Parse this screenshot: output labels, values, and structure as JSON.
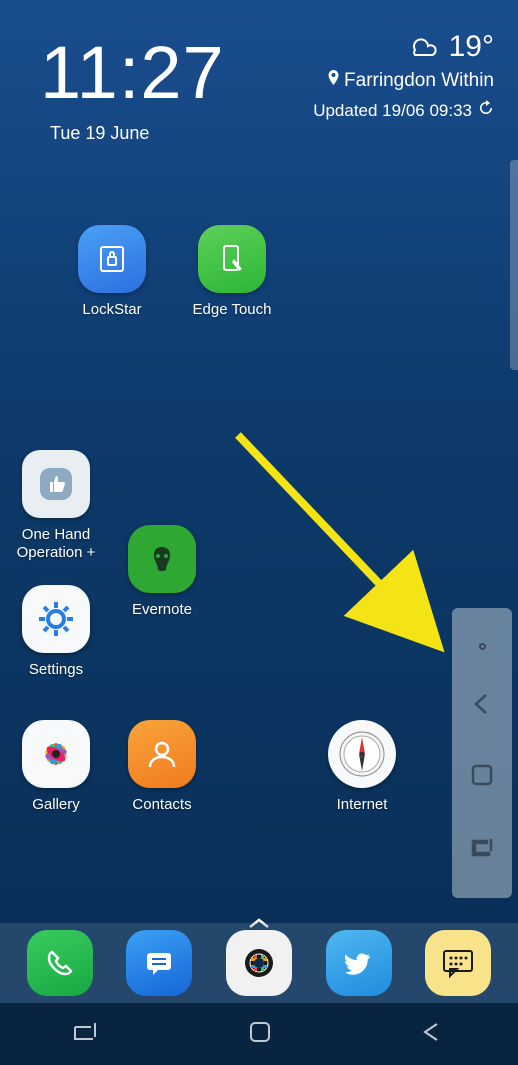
{
  "clock": {
    "time": "11:27",
    "date": "Tue 19 June"
  },
  "weather": {
    "temp": "19°",
    "location": "Farringdon Within",
    "updated": "Updated 19/06 09:33"
  },
  "apps": {
    "lockstar": "LockStar",
    "edgetouch": "Edge Touch",
    "onehand": "One Hand Operation +",
    "evernote": "Evernote",
    "settings": "Settings",
    "gallery": "Gallery",
    "contacts": "Contacts",
    "internet": "Internet"
  },
  "dock": {
    "phone": "Phone",
    "messages": "Messages",
    "camera": "Camera",
    "twitter": "Twitter",
    "bbm": "BBM"
  }
}
